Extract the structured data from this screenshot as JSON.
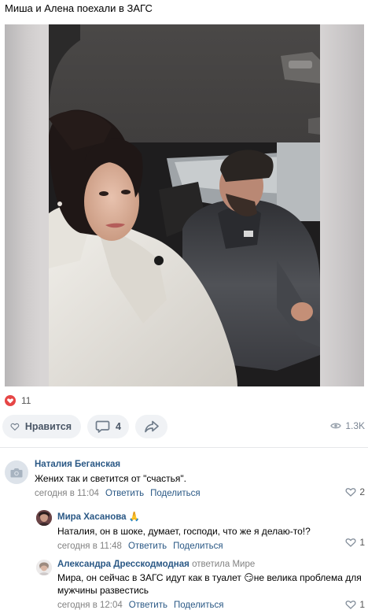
{
  "post": {
    "title": "Миша и Алена поехали в ЗАГС",
    "likes_count": "11",
    "like_label": "Нравится",
    "comments_count": "4",
    "views": "1.3K"
  },
  "colors": {
    "link": "#2a5885",
    "meta": "#828282",
    "like_heart": "#e64646",
    "button_bg": "#f0f2f5"
  },
  "comments": [
    {
      "author": "Наталия Беганская",
      "text": "Жених так и светится от \"счастья\".",
      "time": "сегодня в 11:04",
      "reply_label": "Ответить",
      "share_label": "Поделиться",
      "likes": "2",
      "avatar_icon": "camera-icon"
    },
    {
      "author": "Мира Хасанова 🙏",
      "text": "Наталия, он в шоке, думает, господи, что же я делаю-то!?",
      "time": "сегодня в 11:48",
      "reply_label": "Ответить",
      "share_label": "Поделиться",
      "likes": "1"
    },
    {
      "author": "Александра Дресскодмодная",
      "reply_to": "ответила Мире",
      "text_line1": "Мира, он сейчас в ЗАГС идут как в туалет 😏не велика проблема для",
      "text_line2": "мужчины развестись",
      "time": "сегодня в 12:04",
      "reply_label": "Ответить",
      "share_label": "Поделиться",
      "likes": "1"
    }
  ]
}
